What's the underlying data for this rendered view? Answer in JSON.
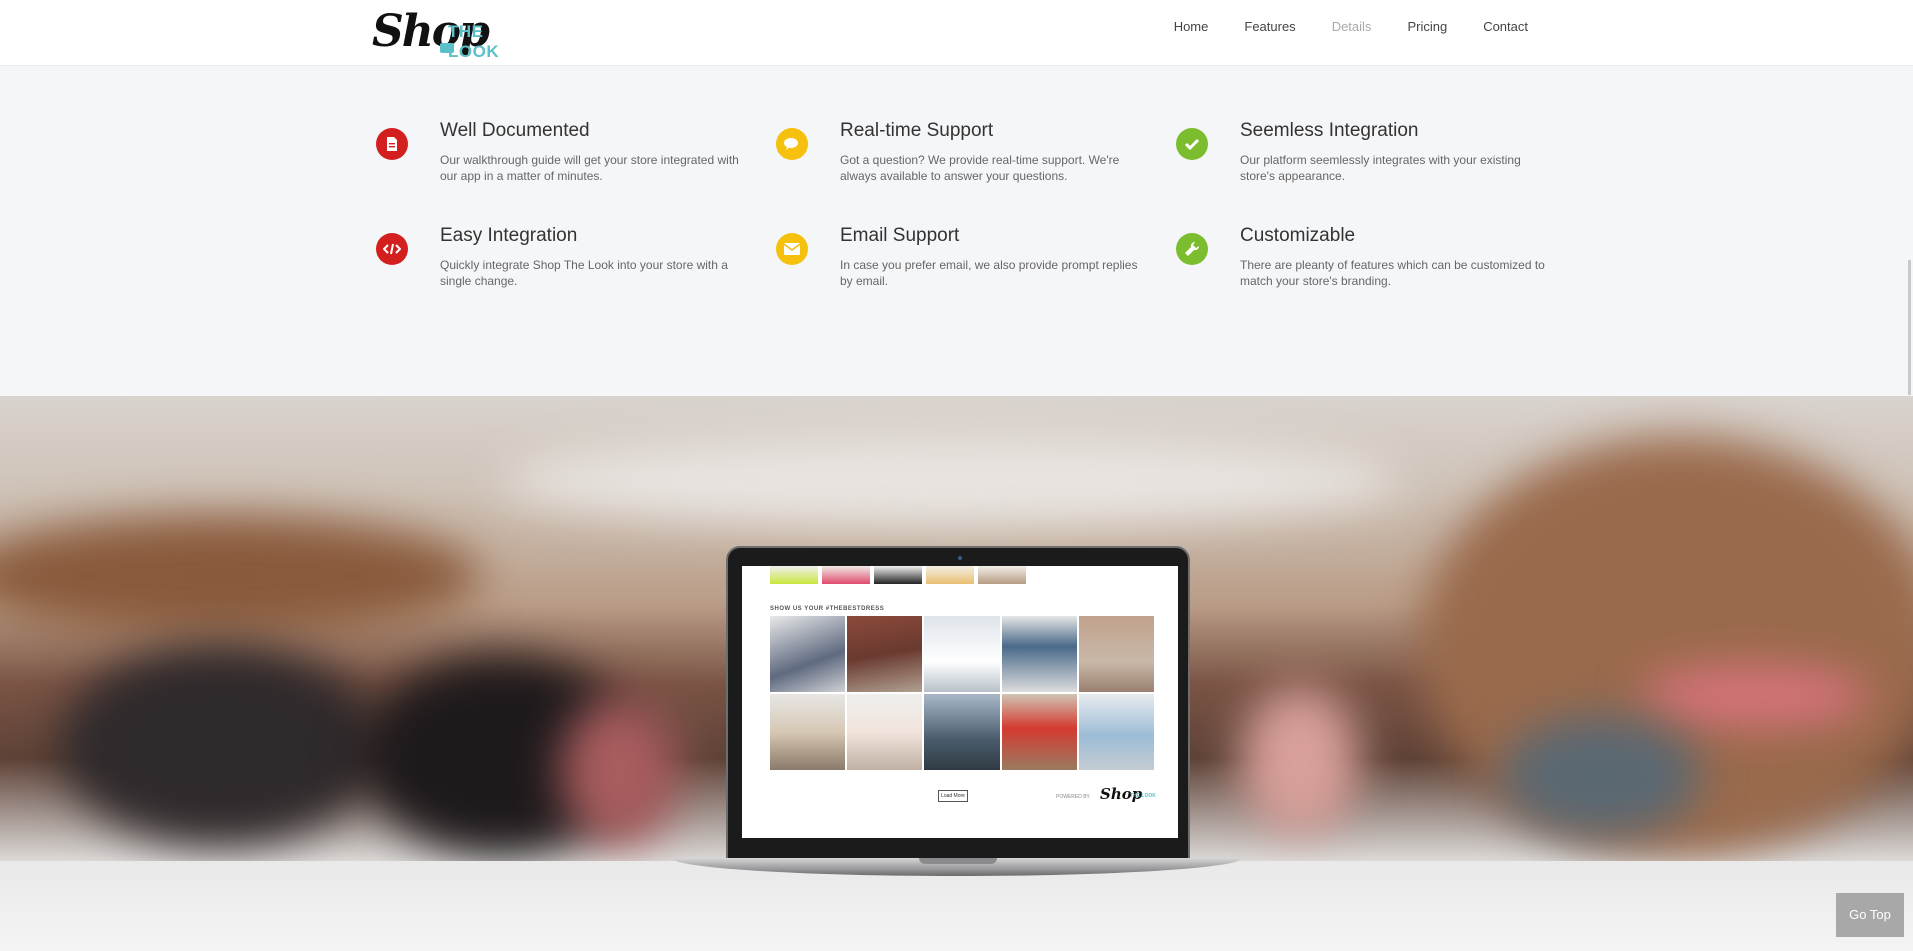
{
  "header": {
    "logo_shop": "Shop",
    "logo_the_look": "THE LOOK",
    "nav": [
      "Home",
      "Features",
      "Details",
      "Pricing",
      "Contact"
    ],
    "active_nav": "Details"
  },
  "features": [
    {
      "title": "Well Documented",
      "desc": "Our walkthrough guide will get your store integrated with our app in a matter of minutes.",
      "icon": "document-icon",
      "color": "#d3201f"
    },
    {
      "title": "Real-time Support",
      "desc": "Got a question? We provide real-time support. We're always available to answer your questions.",
      "icon": "chat-icon",
      "color": "#f5c00e"
    },
    {
      "title": "Seemless Integration",
      "desc": "Our platform seemlessly integrates with your existing store's appearance.",
      "icon": "check-icon",
      "color": "#7cbd2f"
    },
    {
      "title": "Easy Integration",
      "desc": "Quickly integrate Shop The Look into your store with a single change.",
      "icon": "code-icon",
      "color": "#d3201f"
    },
    {
      "title": "Email Support",
      "desc": "In case you prefer email, we also provide prompt replies by email.",
      "icon": "envelope-icon",
      "color": "#f5c00e"
    },
    {
      "title": "Customizable",
      "desc": "There are pleanty of features which can be customized to match your store's branding.",
      "icon": "wrench-icon",
      "color": "#7cbd2f"
    }
  ],
  "screen": {
    "title": "SHOW US YOUR #THEBESTDRESS",
    "load_more": "Load More",
    "powered_by": "POWERED BY",
    "mini_logo": "Shop",
    "mini_the_look": "THE LOOK"
  },
  "go_top": "Go Top"
}
